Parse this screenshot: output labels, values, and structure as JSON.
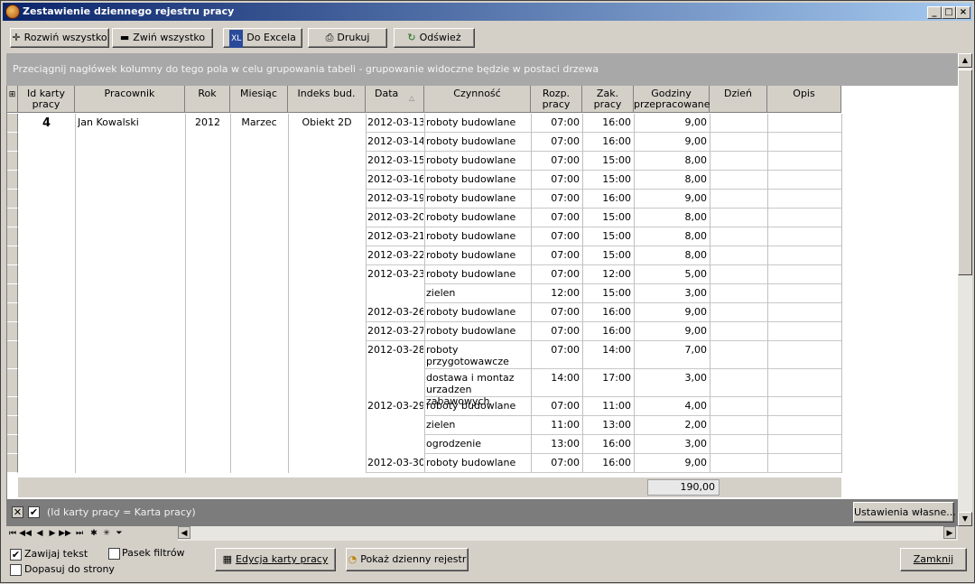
{
  "window": {
    "title": "Zestawienie dziennego rejestru pracy"
  },
  "toolbar": {
    "expand_all": "Rozwiń wszystko",
    "collapse_all": "Zwiń wszystko",
    "excel": "Do Excela",
    "print": "Drukuj",
    "refresh": "Odśwież"
  },
  "group_panel_text": "Przeciągnij nagłówek kolumny do tego pola w celu grupowania tabeli - grupowanie widoczne będzie w postaci drzewa",
  "columns": {
    "id": "Id karty pracy",
    "worker": "Pracownik",
    "year": "Rok",
    "month": "Miesiąc",
    "index": "Indeks bud.",
    "date": "Data",
    "activity": "Czynność",
    "start": "Rozp. pracy",
    "end": "Zak. pracy",
    "hours": "Godziny przepracowane",
    "day": "Dzień",
    "desc": "Opis"
  },
  "group": {
    "id": "4",
    "worker": "Jan Kowalski",
    "year": "2012",
    "month": "Marzec",
    "index": "Obiekt 2D"
  },
  "rows": [
    {
      "date": "2012-03-13",
      "activity": "roboty budowlane",
      "start": "07:00",
      "end": "16:00",
      "hours": "9,00"
    },
    {
      "date": "2012-03-14",
      "activity": "roboty budowlane",
      "start": "07:00",
      "end": "16:00",
      "hours": "9,00"
    },
    {
      "date": "2012-03-15",
      "activity": "roboty budowlane",
      "start": "07:00",
      "end": "15:00",
      "hours": "8,00"
    },
    {
      "date": "2012-03-16",
      "activity": "roboty budowlane",
      "start": "07:00",
      "end": "15:00",
      "hours": "8,00"
    },
    {
      "date": "2012-03-19",
      "activity": "roboty budowlane",
      "start": "07:00",
      "end": "16:00",
      "hours": "9,00"
    },
    {
      "date": "2012-03-20",
      "activity": "roboty budowlane",
      "start": "07:00",
      "end": "15:00",
      "hours": "8,00"
    },
    {
      "date": "2012-03-21",
      "activity": "roboty budowlane",
      "start": "07:00",
      "end": "15:00",
      "hours": "8,00"
    },
    {
      "date": "2012-03-22",
      "activity": "roboty budowlane",
      "start": "07:00",
      "end": "15:00",
      "hours": "8,00"
    },
    {
      "date": "2012-03-23",
      "activity": "roboty budowlane",
      "start": "07:00",
      "end": "12:00",
      "hours": "5,00"
    },
    {
      "date": "",
      "activity": "zielen",
      "start": "12:00",
      "end": "15:00",
      "hours": "3,00"
    },
    {
      "date": "2012-03-26",
      "activity": "roboty budowlane",
      "start": "07:00",
      "end": "16:00",
      "hours": "9,00"
    },
    {
      "date": "2012-03-27",
      "activity": "roboty budowlane",
      "start": "07:00",
      "end": "16:00",
      "hours": "9,00"
    },
    {
      "date": "2012-03-28",
      "activity": "roboty przygotowawcze",
      "start": "07:00",
      "end": "14:00",
      "hours": "7,00"
    },
    {
      "date": "",
      "activity": "dostawa i montaz urzadzen zabawowych",
      "start": "14:00",
      "end": "17:00",
      "hours": "3,00"
    },
    {
      "date": "2012-03-29",
      "activity": "roboty budowlane",
      "start": "07:00",
      "end": "11:00",
      "hours": "4,00"
    },
    {
      "date": "",
      "activity": "zielen",
      "start": "11:00",
      "end": "13:00",
      "hours": "2,00"
    },
    {
      "date": "",
      "activity": "ogrodzenie",
      "start": "13:00",
      "end": "16:00",
      "hours": "3,00"
    },
    {
      "date": "2012-03-30",
      "activity": "roboty budowlane",
      "start": "07:00",
      "end": "16:00",
      "hours": "9,00"
    }
  ],
  "total_hours": "190,00",
  "filter": {
    "text": "(Id karty pracy = Karta pracy)",
    "settings_button": "Ustawienia własne..."
  },
  "bottom": {
    "wrap_text": "Zawijaj tekst",
    "filter_bar": "Pasek filtrów",
    "fit_page": "Dopasuj do strony",
    "edit_card": "Edycja karty pracy",
    "show_register": "Pokaż dzienny rejestr",
    "close": "Zamknij"
  }
}
